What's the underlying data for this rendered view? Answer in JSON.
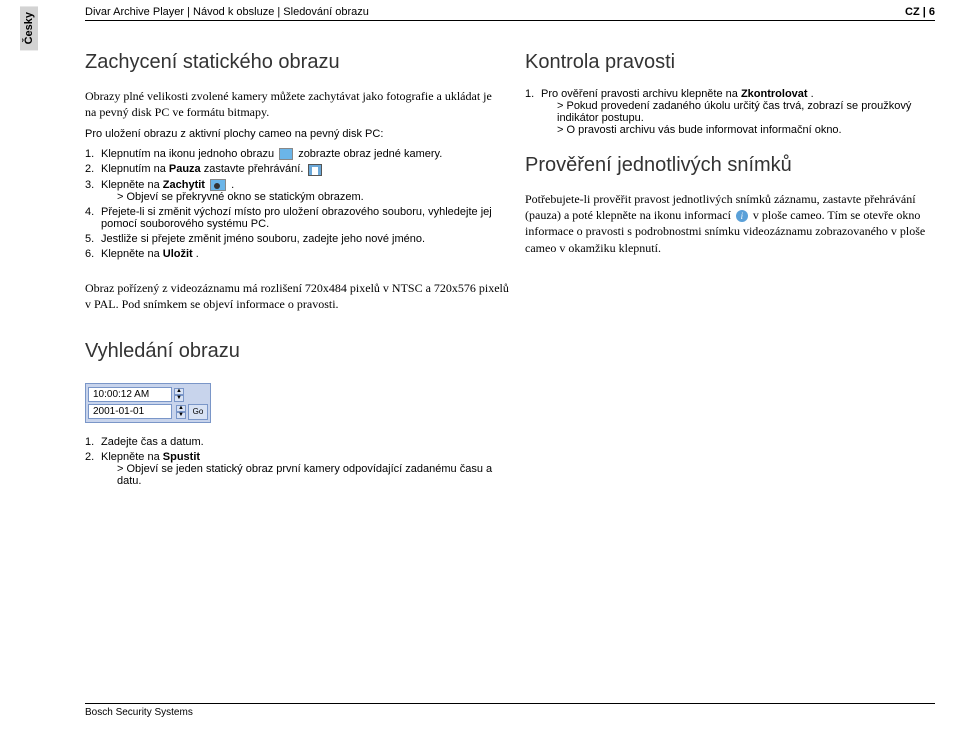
{
  "sideTab": "Česky",
  "header": {
    "breadcrumb": "Divar Archive Player | Návod k obsluze | Sledování obrazu",
    "pageMark": "CZ | 6"
  },
  "left": {
    "h1a": "Zachycení statického obrazu",
    "intro": "Obrazy plné velikosti zvolené kamery můžete zachytávat jako fotografie a ukládat je na pevný disk PC ve formátu bitmapy.",
    "lead": "Pro uložení obrazu z aktivní plochy cameo na pevný disk PC:",
    "i1a": "Klepnutím na ikonu jednoho obrazu ",
    "i1b": " zobrazte obraz jedné kamery.",
    "i2a": "Klepnutím na ",
    "i2bold": "Pauza",
    "i2b": " zastavte přehrávání.",
    "i3a": "Klepněte na ",
    "i3bold": "Zachytit ",
    "i3b": ".",
    "i3sub": "> Objeví se překryvné okno se statickým obrazem.",
    "i4": "Přejete-li si změnit výchozí místo pro uložení obrazového souboru, vyhledejte jej pomocí souborového systému PC.",
    "i5": "Jestliže si přejete změnit jméno souboru, zadejte jeho nové jméno.",
    "i6a": "Klepněte na ",
    "i6bold": "Uložit",
    "i6b": ".",
    "noteFull": "Obraz pořízený z videozáznamu má rozlišení 720x484 pixelů v NTSC a 720x576 pixelů v PAL. Pod snímkem se objeví informace o pravosti.",
    "h1b": "Vyhledání obrazu",
    "searchTime": "10:00:12 AM",
    "searchDate": "2001-01-01",
    "goLabel": "Go",
    "s1": "Zadejte čas a datum.",
    "s2a": "Klepněte na ",
    "s2bold": "Spustit",
    "s2sub": "> Objeví se jeden statický obraz první kamery odpovídající zadanému času a datu."
  },
  "right": {
    "h1a": "Kontrola pravosti",
    "r1a": "Pro ověření pravosti archivu klepněte na ",
    "r1bold": "Zkontrolovat",
    "r1b": ".",
    "r1sub1": "> Pokud provedení zadaného úkolu určitý čas trvá, zobrazí se proužkový indikátor postupu.",
    "r1sub2": "> O pravosti archivu vás bude informovat informační okno.",
    "h1b": "Prověření jednotlivých snímků",
    "para1a": "Potřebujete-li prověřit pravost jednotlivých snímků záznamu, zastavte přehrávání (pauza) a poté klepněte na ikonu informací ",
    "para1b": " v ploše cameo. Tím se otevře okno informace o pravosti s podrobnostmi snímku videozáznamu zobrazovaného v ploše cameo v okamžiku klepnutí."
  },
  "footer": "Bosch Security Systems"
}
